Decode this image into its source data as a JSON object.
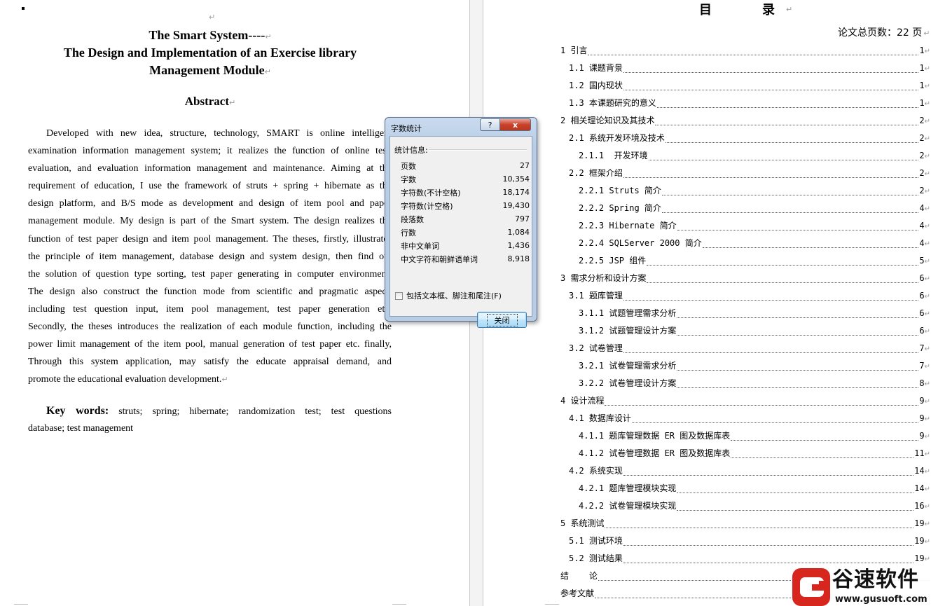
{
  "marks": {
    "para": "↵"
  },
  "left_page": {
    "title_lines": [
      "The Smart System----",
      "The Design and Implementation of an Exercise library",
      "Management Module"
    ],
    "abstract_heading": "Abstract",
    "abstract_lines": [
      "Developed with new idea, structure, technology, SMART is online intelligent",
      "examination information management system; it realizes the function of online test,",
      "evaluation, and evaluation information management and maintenance. Aiming at the",
      "requirement of education, I use the framework of struts + spring + hibernate as the",
      "design platform, and B/S mode as development and design of item pool and paper",
      "management module. My design is part of the Smart system.    The design realizes the",
      "function of test paper design and item pool management. The theses, firstly, illustrates",
      "the principle of item management, database design and system design, then find out",
      "the solution of question type sorting, test paper generating in computer environment.",
      "The design also construct the function mode from scientific and pragmatic aspect,",
      "including test question input, item pool management, test paper generation etc.",
      "Secondly, the theses introduces the realization of each module function, including the",
      "power limit management of the item pool, manual generation of test paper etc. finally,",
      "Through this system application, may satisfy the educate appraisal demand, and",
      "promote the educational evaluation development."
    ],
    "keywords_label": "Key words:",
    "keywords_line1": "struts; spring; hibernate; randomization test; test questions",
    "keywords_line2": "database; test management"
  },
  "right_page": {
    "toc_title_a": "目",
    "toc_title_b": "录",
    "total_pages": "论文总页数：22 页",
    "toc": [
      {
        "level": 1,
        "text": "1 引言",
        "page": "1"
      },
      {
        "level": 2,
        "text": "1.1 课题背景",
        "page": "1"
      },
      {
        "level": 2,
        "text": "1.2 国内现状",
        "page": "1"
      },
      {
        "level": 2,
        "text": "1.3 本课题研究的意义",
        "page": "1"
      },
      {
        "level": 1,
        "text": "2 相关理论知识及其技术",
        "page": "2"
      },
      {
        "level": 2,
        "text": "2.1 系统开发环境及技术",
        "page": "2"
      },
      {
        "level": 3,
        "text": "2.1.1  开发环境",
        "page": "2"
      },
      {
        "level": 2,
        "text": "2.2 框架介绍",
        "page": "2"
      },
      {
        "level": 3,
        "text": "2.2.1 Struts 简介",
        "page": "2"
      },
      {
        "level": 3,
        "text": "2.2.2 Spring 简介",
        "page": "4"
      },
      {
        "level": 3,
        "text": "2.2.3 Hibernate 简介",
        "page": "4"
      },
      {
        "level": 3,
        "text": "2.2.4 SQLServer 2000 简介",
        "page": "4"
      },
      {
        "level": 3,
        "text": "2.2.5 JSP 组件",
        "page": "5"
      },
      {
        "level": 1,
        "text": "3 需求分析和设计方案",
        "page": "6"
      },
      {
        "level": 2,
        "text": "3.1 题库管理",
        "page": "6"
      },
      {
        "level": 3,
        "text": "3.1.1 试题管理需求分析",
        "page": "6"
      },
      {
        "level": 3,
        "text": "3.1.2 试题管理设计方案",
        "page": "6"
      },
      {
        "level": 2,
        "text": "3.2 试卷管理",
        "page": "7"
      },
      {
        "level": 3,
        "text": "3.2.1 试卷管理需求分析",
        "page": "7"
      },
      {
        "level": 3,
        "text": "3.2.2 试卷管理设计方案",
        "page": "8"
      },
      {
        "level": 1,
        "text": "4 设计流程",
        "page": "9"
      },
      {
        "level": 2,
        "text": "4.1 数据库设计",
        "page": "9"
      },
      {
        "level": 3,
        "text": "4.1.1 题库管理数据 ER 图及数据库表",
        "page": "9"
      },
      {
        "level": 3,
        "text": "4.1.2 试卷管理数据 ER 图及数据库表",
        "page": "11"
      },
      {
        "level": 2,
        "text": "4.2 系统实现",
        "page": "14"
      },
      {
        "level": 3,
        "text": "4.2.1 题库管理模块实现",
        "page": "14"
      },
      {
        "level": 3,
        "text": "4.2.2 试卷管理模块实现",
        "page": "16"
      },
      {
        "level": 1,
        "text": "5 系统测试",
        "page": "19"
      },
      {
        "level": 2,
        "text": "5.1 测试环境",
        "page": "19"
      },
      {
        "level": 2,
        "text": "5.2 测试结果",
        "page": "19"
      },
      {
        "level": 1,
        "text": "结    论",
        "page": ""
      },
      {
        "level": 1,
        "text": "参考文献",
        "page": ""
      }
    ]
  },
  "dialog": {
    "title": "字数统计",
    "help_label": "?",
    "close_x_label": "x",
    "stats_heading": "统计信息:",
    "stats": [
      {
        "label": "页数",
        "value": "27"
      },
      {
        "label": "字数",
        "value": "10,354"
      },
      {
        "label": "字符数(不计空格)",
        "value": "18,174"
      },
      {
        "label": "字符数(计空格)",
        "value": "19,430"
      },
      {
        "label": "段落数",
        "value": "797"
      },
      {
        "label": "行数",
        "value": "1,084"
      },
      {
        "label": "非中文单词",
        "value": "1,436"
      },
      {
        "label": "中文字符和朝鲜语单词",
        "value": "8,918"
      }
    ],
    "include_label": "包括文本框、脚注和尾注(F)",
    "include_checked": false,
    "close_button_label": "关闭"
  },
  "watermark": {
    "name": "谷速软件",
    "url": "www.gusuoft.com",
    "brand_color": "#d7261e"
  }
}
